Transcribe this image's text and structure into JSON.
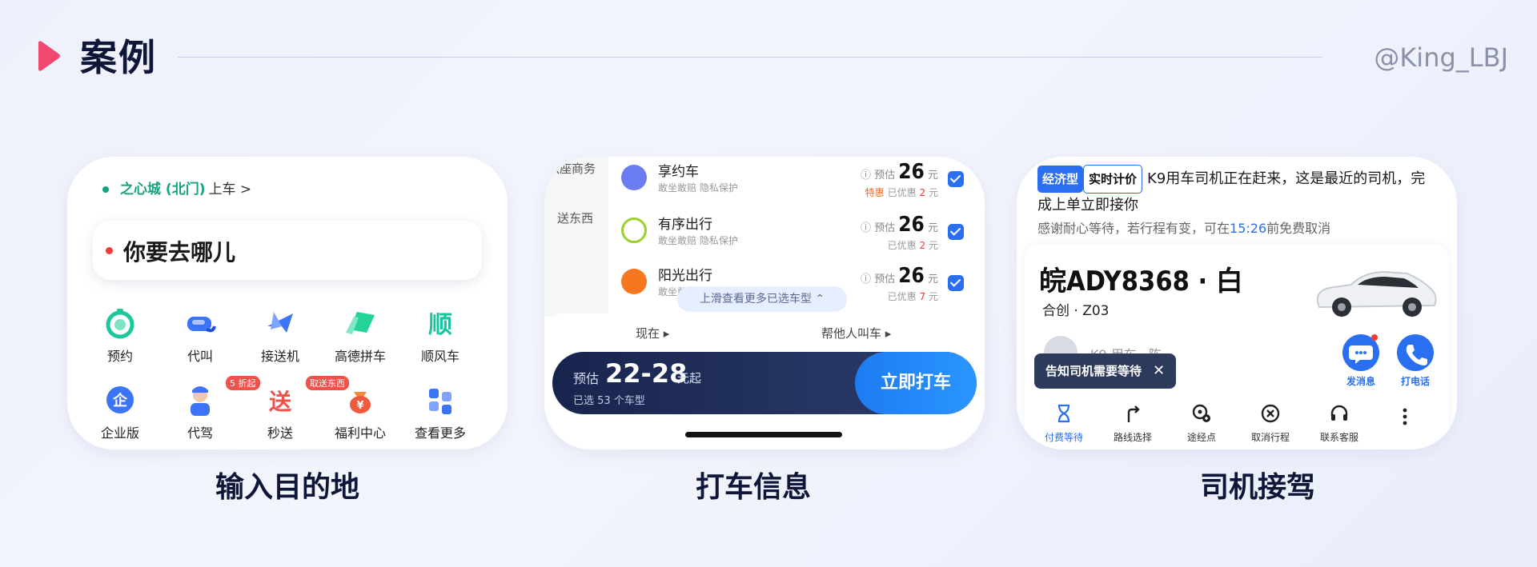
{
  "header": {
    "title": "案例",
    "author": "@King_LBJ",
    "accent_color": "#f0486e"
  },
  "card1": {
    "caption": "输入目的地",
    "pickup_place": "之心城 (北门)",
    "pickup_suffix": "上车 >",
    "destination_placeholder": "你要去哪儿",
    "services": [
      {
        "label": "预约",
        "icon": "clock-icon"
      },
      {
        "label": "代叫",
        "icon": "call-car-icon"
      },
      {
        "label": "接送机",
        "icon": "plane-icon"
      },
      {
        "label": "高德拼车",
        "icon": "carpool-icon"
      },
      {
        "label": "顺风车",
        "icon": "shunfeng-icon"
      },
      {
        "label": "企业版",
        "icon": "enterprise-icon"
      },
      {
        "label": "代驾",
        "icon": "designated-driver-icon",
        "badge": "5 折起"
      },
      {
        "label": "秒送",
        "icon": "delivery-icon",
        "badge": "取送东西"
      },
      {
        "label": "福利中心",
        "icon": "welfare-icon"
      },
      {
        "label": "查看更多",
        "icon": "more-grid-icon"
      }
    ]
  },
  "card2": {
    "caption": "打车信息",
    "side_items": [
      "六座商务",
      "送东西"
    ],
    "rides": [
      {
        "name": "享约车",
        "sub": "敢坐敢赔 隐私保护",
        "est_label": "预估",
        "price": "26",
        "unit": "元",
        "special": "特惠",
        "discount_label": "已优惠",
        "discount": "2",
        "discount_unit": "元",
        "logo_color": "#6a7cf0"
      },
      {
        "name": "有序出行",
        "sub": "敢坐敢赔 隐私保护",
        "est_label": "预估",
        "price": "26",
        "unit": "元",
        "special": "",
        "discount_label": "已优惠",
        "discount": "2",
        "discount_unit": "元",
        "logo_color": "#9bd12d"
      },
      {
        "name": "阳光出行",
        "sub": "敢坐敢赔 隐私保护",
        "est_label": "预估",
        "price": "26",
        "unit": "元",
        "special": "",
        "discount_label": "已优惠",
        "discount": "7",
        "discount_unit": "元",
        "logo_color": "#f5781f"
      }
    ],
    "more_pill": "上滑查看更多已选车型",
    "option_now": "现在 ▸",
    "option_other": "帮他人叫车 ▸",
    "estimate_label": "预估",
    "price_range": "22-28",
    "price_unit": "元起",
    "selected_count": "已选 53 个车型",
    "call_button": "立即打车"
  },
  "card3": {
    "caption": "司机接驾",
    "tag_economy": "经济型",
    "tag_realtime": "实时计价",
    "status_text": "K9用车司机正在赶来，这是最近的司机，完成上单立即接你",
    "wait_prefix": "感谢耐心等待，若行程有变，可在",
    "wait_time": "15:26",
    "wait_suffix": "前免费取消",
    "plate": "皖ADY8368 · 白",
    "model": "合创 · Z03",
    "driver_name": "K9 用车 · 陈",
    "tooltip": "告知司机需要等待",
    "action_message": "发消息",
    "action_call": "打电话",
    "tools": [
      {
        "label": "付费等待",
        "icon": "wait-icon"
      },
      {
        "label": "路线选择",
        "icon": "route-icon"
      },
      {
        "label": "途经点",
        "icon": "waypoint-icon"
      },
      {
        "label": "取消行程",
        "icon": "cancel-icon"
      },
      {
        "label": "联系客服",
        "icon": "headset-icon"
      }
    ]
  }
}
